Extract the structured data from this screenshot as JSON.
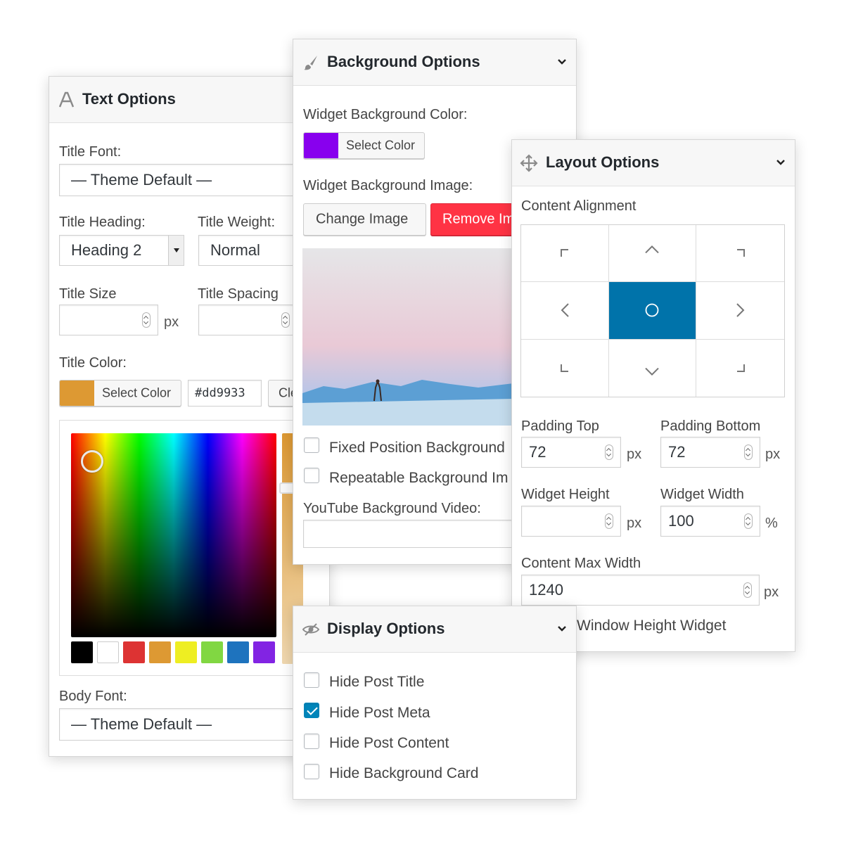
{
  "text_options": {
    "title": "Text Options",
    "title_font_label": "Title Font:",
    "title_font_value": "— Theme Default —",
    "title_heading_label": "Title Heading:",
    "title_heading_value": "Heading 2",
    "title_weight_label": "Title Weight:",
    "title_weight_value": "Normal",
    "title_size_label": "Title Size",
    "title_size_unit": "px",
    "title_spacing_label": "Title Spacing",
    "title_color_label": "Title Color:",
    "title_color_swatch": "#dd9933",
    "select_color_label": "Select Color",
    "hex_value": "#dd9933",
    "clear_label": "Cle",
    "palette": [
      "#000000",
      "#ffffff",
      "#dd3333",
      "#dd9933",
      "#eeee22",
      "#81d742",
      "#1e73be",
      "#8224e3"
    ],
    "body_font_label": "Body Font:",
    "body_font_value": "— Theme Default —"
  },
  "background_options": {
    "title": "Background Options",
    "bg_color_label": "Widget Background Color:",
    "bg_color_swatch": "#8800ee",
    "select_color_label": "Select Color",
    "bg_image_label": "Widget Background Image:",
    "change_image_label": "Change Image",
    "remove_image_label": "Remove Im",
    "fixed_position_label": "Fixed Position Background",
    "fixed_position_checked": false,
    "repeatable_label": "Repeatable Background Im",
    "repeatable_checked": false,
    "youtube_label": "YouTube Background Video:"
  },
  "layout_options": {
    "title": "Layout Options",
    "content_alignment_label": "Content Alignment",
    "alignment_cells": [
      "top-left",
      "top",
      "top-right",
      "left",
      "center",
      "right",
      "bottom-left",
      "bottom",
      "bottom-right"
    ],
    "alignment_selected": "center",
    "padding_top_label": "Padding Top",
    "padding_top_value": "72",
    "padding_top_unit": "px",
    "padding_bottom_label": "Padding Bottom",
    "padding_bottom_value": "72",
    "padding_bottom_unit": "px",
    "widget_height_label": "Widget Height",
    "widget_height_unit": "px",
    "widget_width_label": "Widget Width",
    "widget_width_value": "100",
    "widget_width_unit": "%",
    "content_max_width_label": "Content Max Width",
    "content_max_width_value": "1240",
    "content_max_width_unit": "px",
    "window_height_label": "Window Height Widget"
  },
  "display_options": {
    "title": "Display Options",
    "items": [
      {
        "label": "Hide Post Title",
        "checked": false
      },
      {
        "label": "Hide Post Meta",
        "checked": true
      },
      {
        "label": "Hide Post Content",
        "checked": false
      },
      {
        "label": "Hide Background Card",
        "checked": false
      }
    ]
  },
  "accent_color": "#0073aa",
  "remove_button_color": "#ff3344"
}
